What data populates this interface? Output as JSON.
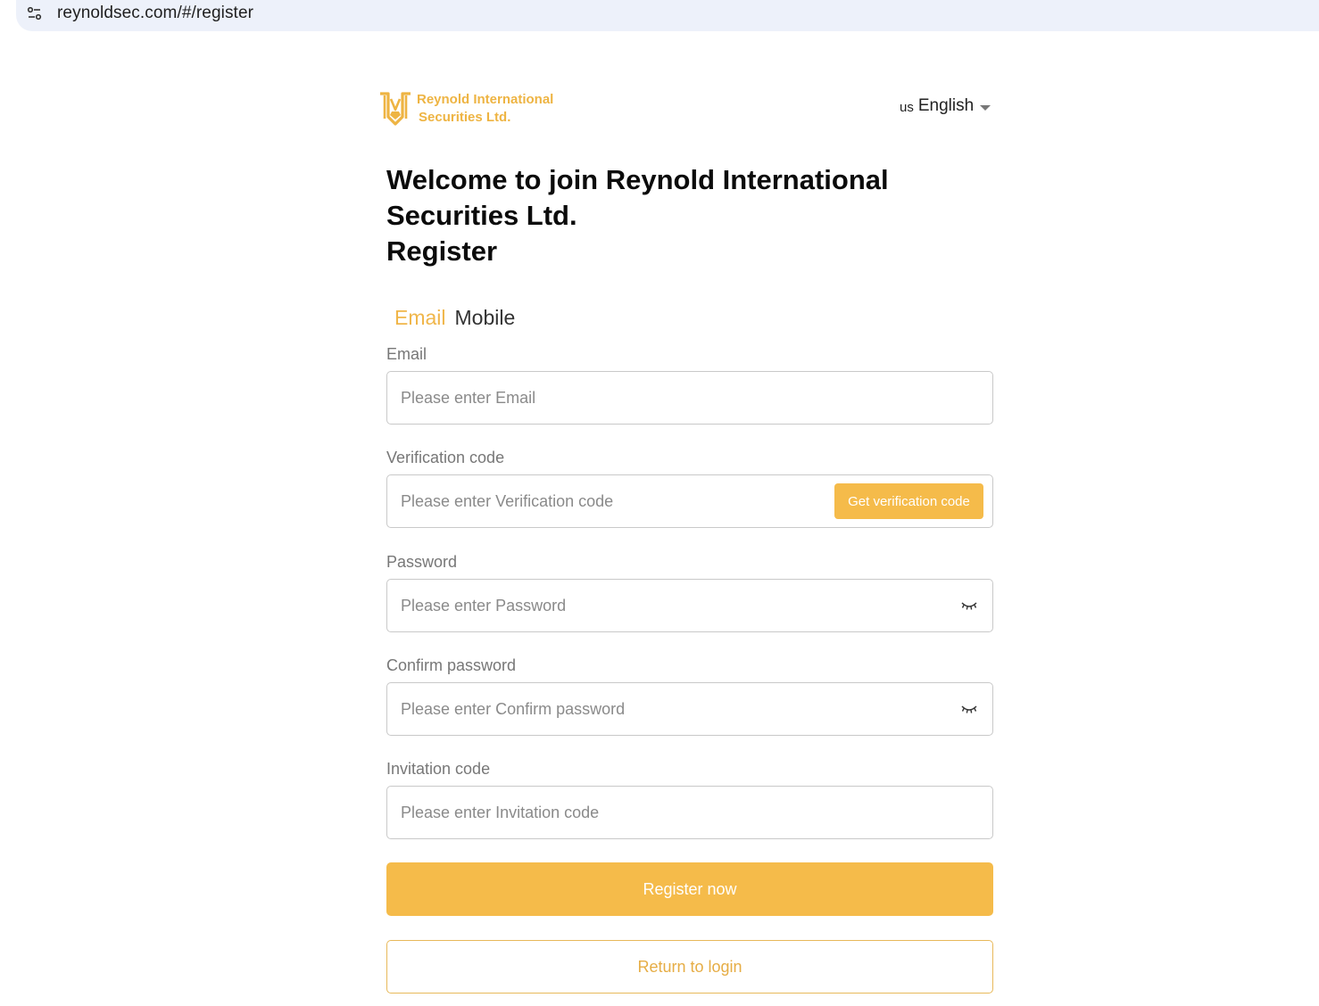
{
  "browser": {
    "url": "reynoldsec.com/#/register",
    "site_info_icon": "tune-icon"
  },
  "header": {
    "logo_line1": "Reynold International",
    "logo_line2": "Securities Ltd.",
    "language_flag": "us",
    "language_label": "English"
  },
  "titles": {
    "welcome": "Welcome to join Reynold International Securities Ltd.",
    "register": "Register"
  },
  "tabs": [
    {
      "label": "Email",
      "active": true
    },
    {
      "label": "Mobile",
      "active": false
    }
  ],
  "form": {
    "email": {
      "label": "Email",
      "placeholder": "Please enter Email",
      "value": ""
    },
    "verification": {
      "label": "Verification code",
      "placeholder": "Please enter Verification code",
      "value": "",
      "button_label": "Get verification code"
    },
    "password": {
      "label": "Password",
      "placeholder": "Please enter Password",
      "value": "",
      "toggle_icon": "eye-closed-icon"
    },
    "confirm_password": {
      "label": "Confirm password",
      "placeholder": "Please enter Confirm password",
      "value": "",
      "toggle_icon": "eye-closed-icon"
    },
    "invitation": {
      "label": "Invitation code",
      "placeholder": "Please enter Invitation code",
      "value": ""
    }
  },
  "actions": {
    "register_label": "Register now",
    "return_label": "Return to login"
  },
  "colors": {
    "accent": "#f5bb4a",
    "logo": "#eeb443",
    "border": "#c9c9c9",
    "address_bar": "#edf1fa"
  }
}
